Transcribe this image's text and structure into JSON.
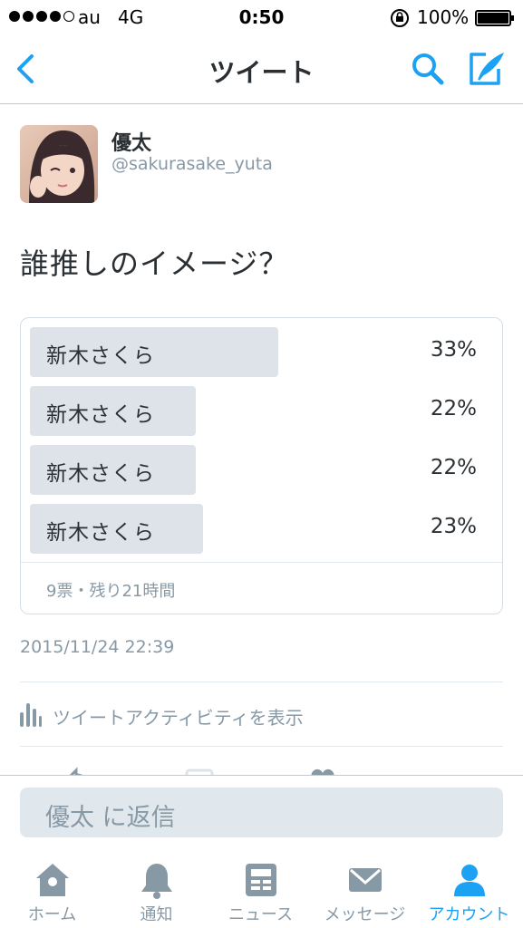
{
  "status_bar": {
    "carrier": "au",
    "network": "4G",
    "time": "0:50",
    "battery": "100%"
  },
  "nav": {
    "title": "ツイート",
    "icons": [
      "chevron-left-icon",
      "search-icon",
      "compose-icon"
    ],
    "accent_color": "#1da1f2"
  },
  "tweet": {
    "display_name": "優太",
    "username": "@sakurasake_yuta",
    "text": "誰推しのイメージ？",
    "timestamp": "2015/11/24 22:39"
  },
  "poll": {
    "options": [
      {
        "label": "新木さくら",
        "percent_text": "33%",
        "percent": 33
      },
      {
        "label": "新木さくら",
        "percent_text": "22%",
        "percent": 22
      },
      {
        "label": "新木さくら",
        "percent_text": "22%",
        "percent": 22
      },
      {
        "label": "新木さくら",
        "percent_text": "23%",
        "percent": 23
      }
    ],
    "meta": "9票・残り21時間"
  },
  "activity": {
    "label": "ツイートアクティビティを表示",
    "icon": "bar-chart-icon"
  },
  "reply": {
    "placeholder": "優太 に返信"
  },
  "tabs": [
    {
      "label": "ホーム",
      "icon": "home-icon",
      "active": false
    },
    {
      "label": "通知",
      "icon": "bell-icon",
      "active": false
    },
    {
      "label": "ニュース",
      "icon": "news-icon",
      "active": false
    },
    {
      "label": "メッセージ",
      "icon": "envelope-icon",
      "active": false
    },
    {
      "label": "アカウント",
      "icon": "person-icon",
      "active": true
    }
  ]
}
